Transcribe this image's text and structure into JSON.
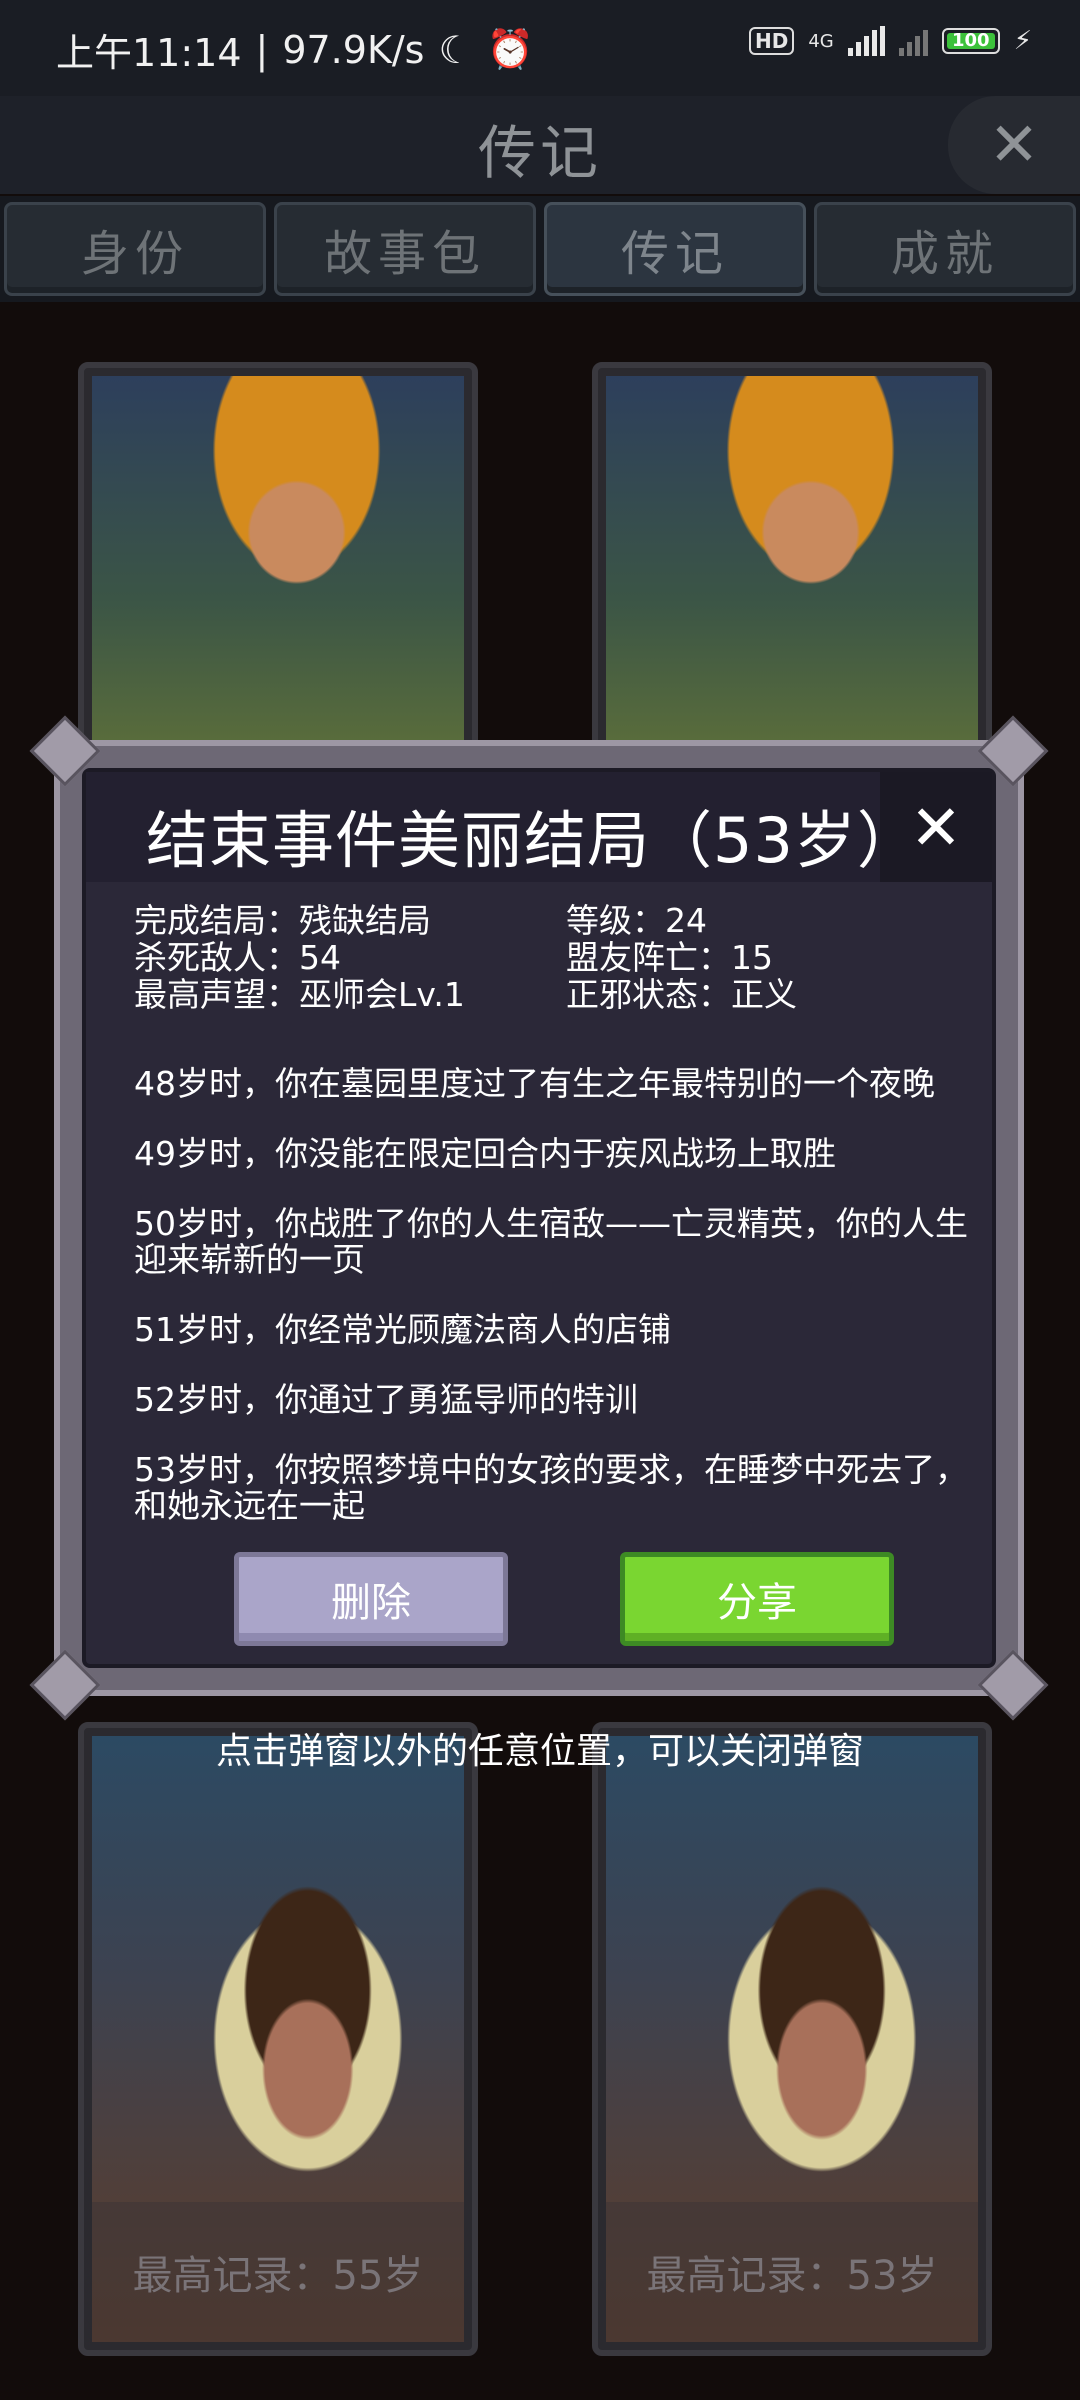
{
  "status_bar": {
    "time": "上午11:14",
    "speed": "97.9K/s",
    "network": "4G",
    "hd": "HD",
    "battery": "100"
  },
  "header": {
    "title": "传记",
    "close_icon": "close-icon"
  },
  "tabs": [
    {
      "label": "身份"
    },
    {
      "label": "故事包"
    },
    {
      "label": "传记"
    },
    {
      "label": "成就"
    }
  ],
  "cards": [
    {
      "portrait": "blond-young-man"
    },
    {
      "portrait": "blond-young-man"
    },
    {
      "portrait": "hooded-young-man",
      "record": "最高记录：55岁"
    },
    {
      "portrait": "hooded-young-man",
      "record": "最高记录：53岁"
    }
  ],
  "modal": {
    "title": "结束事件美丽结局（53岁）",
    "stats": {
      "ending": "完成结局：残缺结局",
      "level": "等级：24",
      "kills": "杀死敌人：54",
      "ally_deaths": "盟友阵亡：15",
      "reputation": "最高声望：巫师会Lv.1",
      "alignment": "正邪状态：正义"
    },
    "events": [
      "48岁时，你在墓园里度过了有生之年最特别的一个夜晚",
      "49岁时，你没能在限定回合内于疾风战场上取胜",
      "50岁时，你战胜了你的人生宿敌——亡灵精英，你的人生迎来崭新的一页",
      "51岁时，你经常光顾魔法商人的店铺",
      "52岁时，你通过了勇猛导师的特训",
      "53岁时，你按照梦境中的女孩的要求，在睡梦中死去了，和她永远在一起"
    ],
    "delete_label": "删除",
    "share_label": "分享"
  },
  "hint": "点击弹窗以外的任意位置，可以关闭弹窗",
  "colors": {
    "share_button": "#7ad631",
    "delete_button": "#aaa5c9",
    "modal_bg": "#2b2838"
  }
}
